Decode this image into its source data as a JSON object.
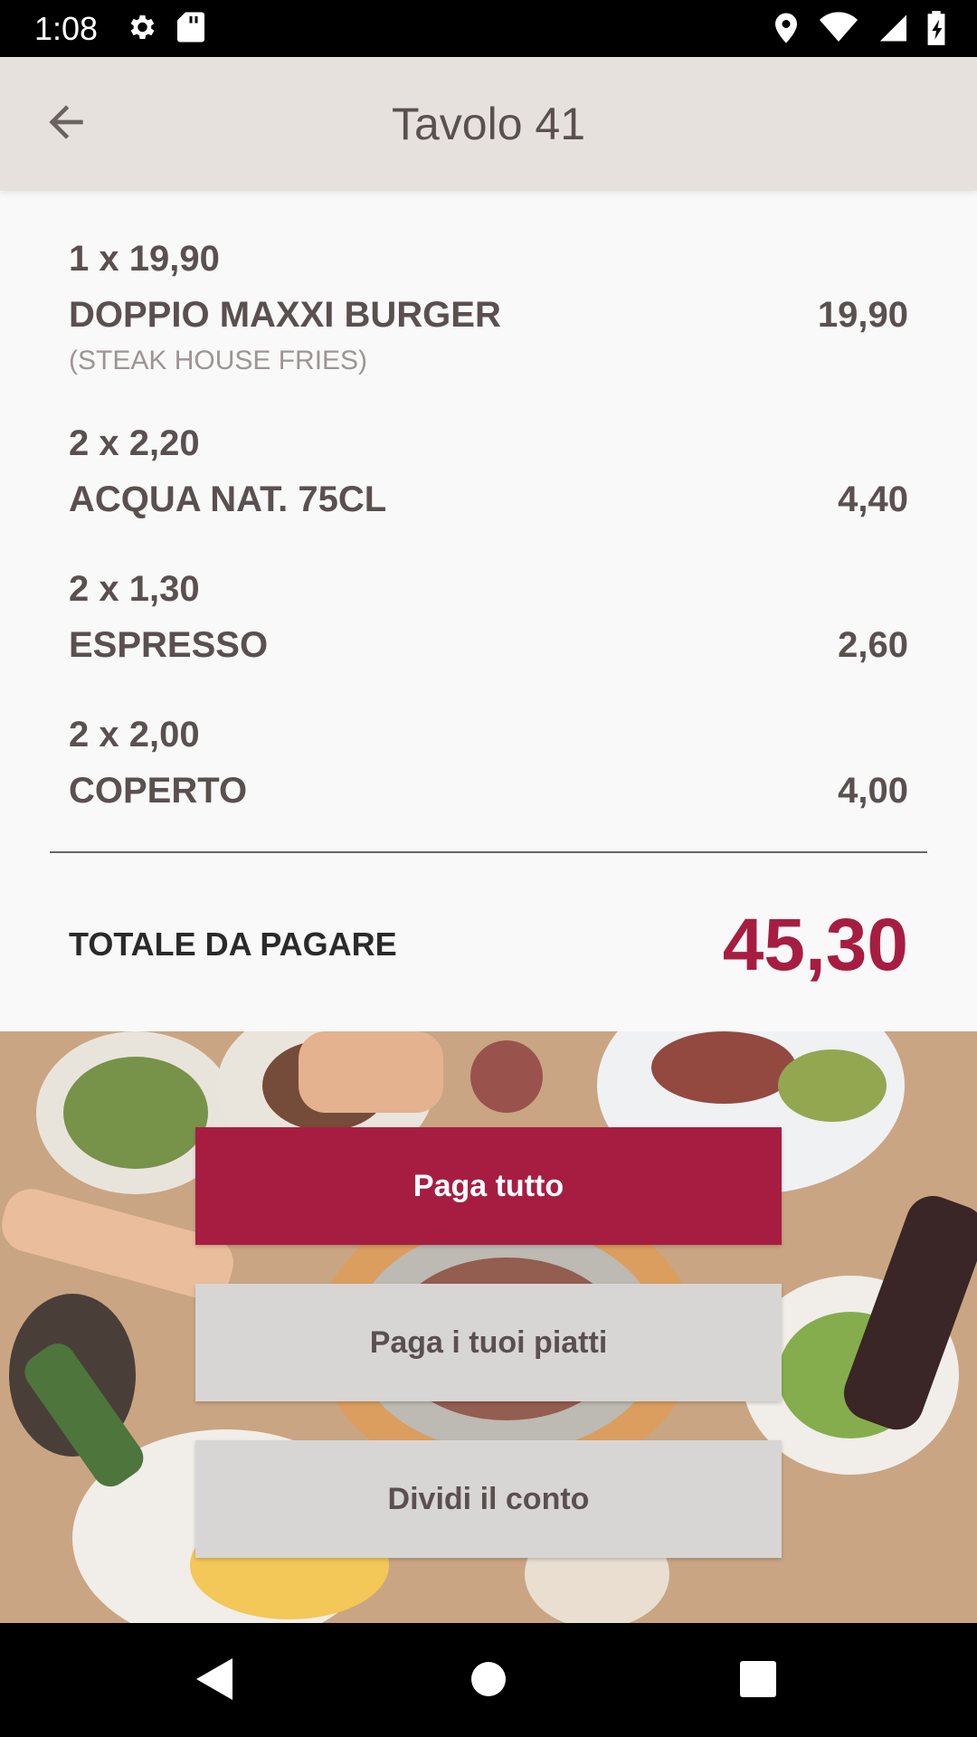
{
  "status_bar": {
    "time": "1:08",
    "left_icons": [
      "gear-icon",
      "sd-card-icon"
    ],
    "right_icons": [
      "location-icon",
      "wifi-icon",
      "signal-icon",
      "battery-icon"
    ]
  },
  "app_bar": {
    "title": "Tavolo 41",
    "back_icon": "arrow-left-icon"
  },
  "order": {
    "items": [
      {
        "qty_price": "1 x 19,90",
        "name": "DOPPIO MAXXI BURGER",
        "note": "(STEAK HOUSE FRIES)",
        "total": "19,90"
      },
      {
        "qty_price": "2 x 2,20",
        "name": "ACQUA NAT. 75CL",
        "note": "",
        "total": "4,40"
      },
      {
        "qty_price": "2 x 1,30",
        "name": "ESPRESSO",
        "note": "",
        "total": "2,60"
      },
      {
        "qty_price": "2 x 2,00",
        "name": "COPERTO",
        "note": "",
        "total": "4,00"
      }
    ],
    "total_label": "TOTALE DA PAGARE",
    "total_value": "45,30"
  },
  "actions": {
    "pay_all": "Paga tutto",
    "pay_your_dishes": "Paga i tuoi piatti",
    "split_bill": "Dividi il conto"
  },
  "nav_bar": {
    "icons": [
      "back-triangle-icon",
      "home-circle-icon",
      "recents-square-icon"
    ]
  },
  "colors": {
    "accent": "#a71d42",
    "app_bar_bg": "#e6e1dc",
    "text_primary": "#5a5050",
    "secondary_button_bg": "#d8d6d4"
  }
}
